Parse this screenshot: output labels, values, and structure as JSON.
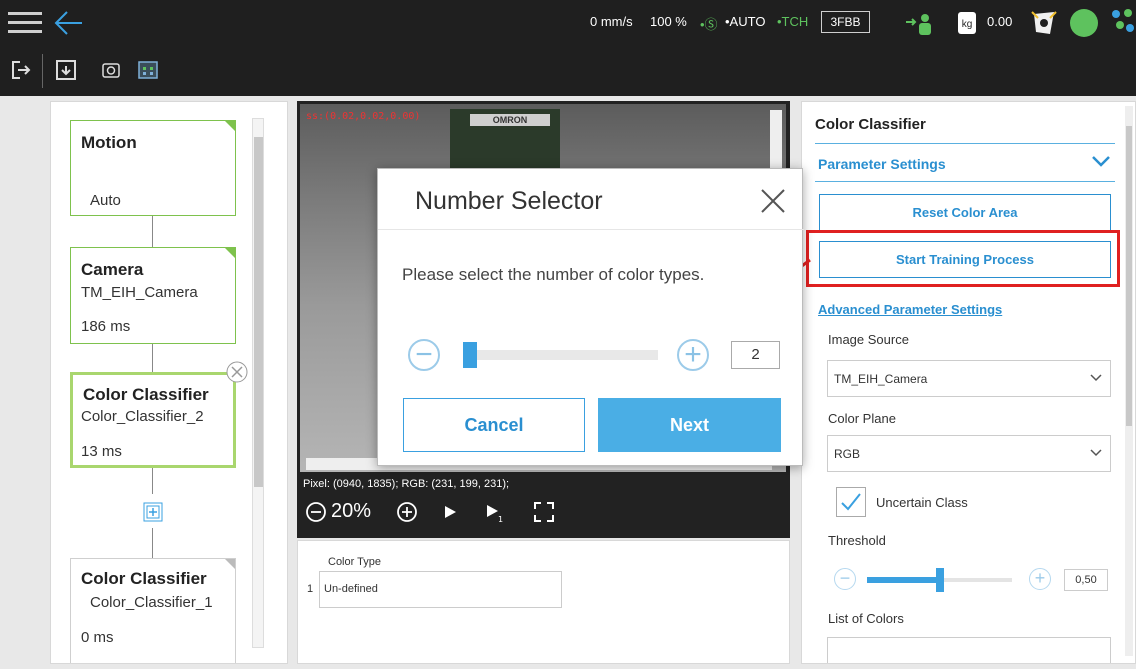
{
  "topbar": {
    "speed": "0 mm/s",
    "percent": "100 %",
    "safety": "•Ⓢ",
    "auto": "•AUTO",
    "tch": "•TCH",
    "project_code": "3FBB",
    "payload": "0.00",
    "kg_label": "kg"
  },
  "flow": {
    "nodes": [
      {
        "title": "Motion",
        "sub": "Auto",
        "ms": ""
      },
      {
        "title": "Camera",
        "sub": "TM_EIH_Camera",
        "ms": "186 ms"
      },
      {
        "title": "Color Classifier",
        "sub": "Color_Classifier_2",
        "ms": "13 ms"
      },
      {
        "title": "Color Classifier",
        "sub": "Color_Classifier_1",
        "ms": "0 ms"
      }
    ]
  },
  "camera": {
    "coord": "ss:(0.02,0.02,0.00)",
    "label": "OMRON",
    "pixel_info": "Pixel: (0940, 1835); RGB: (231, 199, 231);",
    "zoom": "20%"
  },
  "color_type": {
    "header": "Color Type",
    "rows": [
      {
        "num": "1",
        "value": "Un-defined"
      }
    ]
  },
  "right_panel": {
    "title": "Color Classifier",
    "section": "Parameter Settings",
    "reset_btn": "Reset Color Area",
    "start_btn": "Start Training Process",
    "advanced_link": "Advanced Parameter Settings",
    "image_source_label": "Image Source",
    "image_source_value": "TM_EIH_Camera",
    "color_plane_label": "Color Plane",
    "color_plane_value": "RGB",
    "uncertain_label": "Uncertain Class",
    "threshold_label": "Threshold",
    "threshold_value": "0,50",
    "threshold_level": 0.5,
    "list_label": "List of Colors"
  },
  "modal": {
    "title": "Number Selector",
    "message": "Please select the number of color types.",
    "value": "2",
    "cancel": "Cancel",
    "next": "Next"
  },
  "colors": {
    "accent": "#2a8fd0",
    "highlight": "#e02020",
    "node_border": "#7ec24d"
  }
}
